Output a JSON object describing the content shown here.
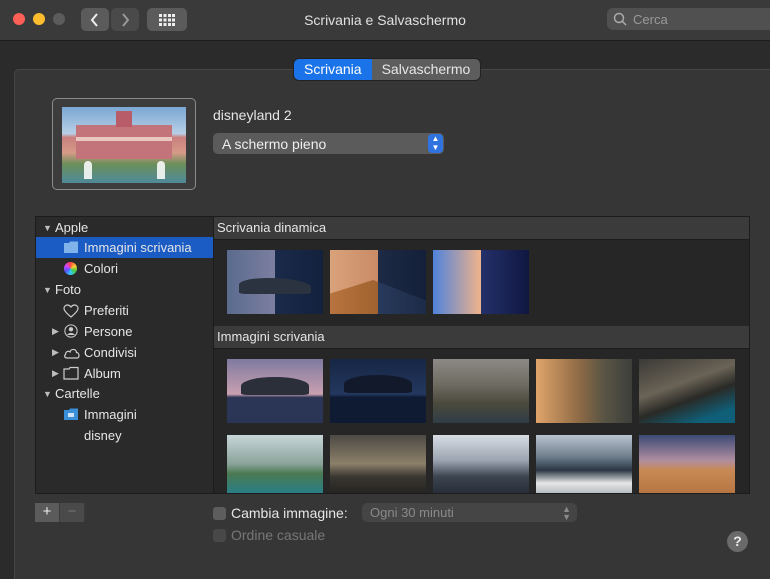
{
  "window": {
    "title": "Scrivania e Salvaschermo"
  },
  "search": {
    "placeholder": "Cerca"
  },
  "tabs": [
    {
      "label": "Scrivania",
      "active": true
    },
    {
      "label": "Salvaschermo",
      "active": false
    }
  ],
  "current": {
    "name": "disneyland 2",
    "fit_option": "A schermo pieno"
  },
  "sidebar": {
    "items": [
      {
        "label": "Apple",
        "type": "group"
      },
      {
        "label": "Immagini scrivania",
        "type": "folder",
        "selected": true
      },
      {
        "label": "Colori",
        "type": "colors"
      },
      {
        "label": "Foto",
        "type": "group"
      },
      {
        "label": "Preferiti",
        "type": "heart"
      },
      {
        "label": "Persone",
        "type": "person"
      },
      {
        "label": "Condivisi",
        "type": "cloud"
      },
      {
        "label": "Album",
        "type": "folder"
      },
      {
        "label": "Cartelle",
        "type": "group"
      },
      {
        "label": "Immagini",
        "type": "folder-blue"
      },
      {
        "label": "disney",
        "type": "none"
      }
    ]
  },
  "gallery": {
    "dynamic_header": "Scrivania dinamica",
    "images_header": "Immagini scrivania"
  },
  "controls": {
    "change_picture_label": "Cambia immagine:",
    "interval_value": "Ogni 30 minuti",
    "random_order_label": "Ordine casuale",
    "add_label": "+",
    "remove_label": "−",
    "help_label": "?"
  },
  "colors": {
    "accent": "#1a73e8",
    "selection": "#1a5bc4"
  }
}
